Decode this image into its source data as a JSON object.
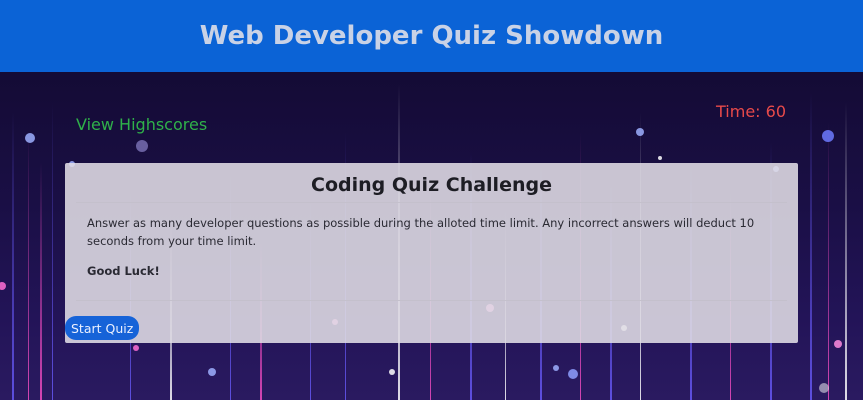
{
  "header": {
    "title": "Web Developer Quiz Showdown"
  },
  "nav": {
    "highscores_link": "View Highscores",
    "timer_text": "Time: 60"
  },
  "card": {
    "title": "Coding Quiz Challenge",
    "description": "Answer as many developer questions as possible during the alloted time limit. Any incorrect answers will deduct 10 seconds from your time limit.",
    "closing": "Good Luck!",
    "start_button": "Start Quiz"
  },
  "colors": {
    "header_bg": "#0b63d6",
    "highscores": "#2fb14a",
    "timer": "#e84a4a",
    "button": "#1663d8"
  }
}
